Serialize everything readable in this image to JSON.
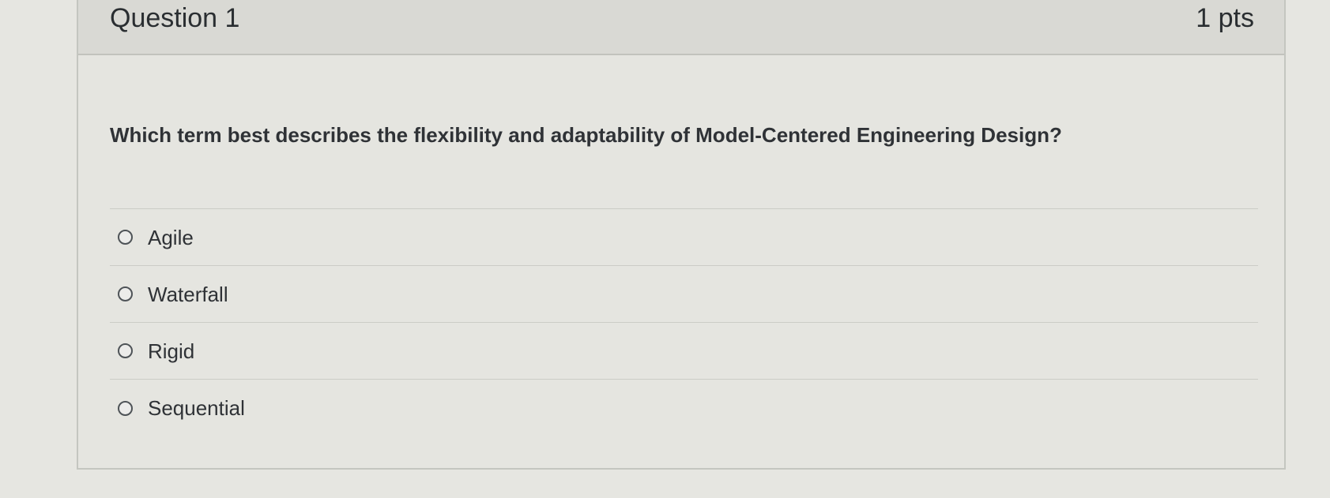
{
  "question": {
    "title": "Question 1",
    "points": "1 pts",
    "text": "Which term best describes the flexibility and adaptability of Model-Centered Engineering Design?",
    "answers": [
      {
        "label": "Agile",
        "selected": false
      },
      {
        "label": "Waterfall",
        "selected": false
      },
      {
        "label": "Rigid",
        "selected": false
      },
      {
        "label": "Sequential",
        "selected": false
      }
    ]
  },
  "colors": {
    "page_background": "#e6e6e1",
    "header_background": "#d9d9d4",
    "text": "#2f3236",
    "divider": "#cbccc6"
  }
}
